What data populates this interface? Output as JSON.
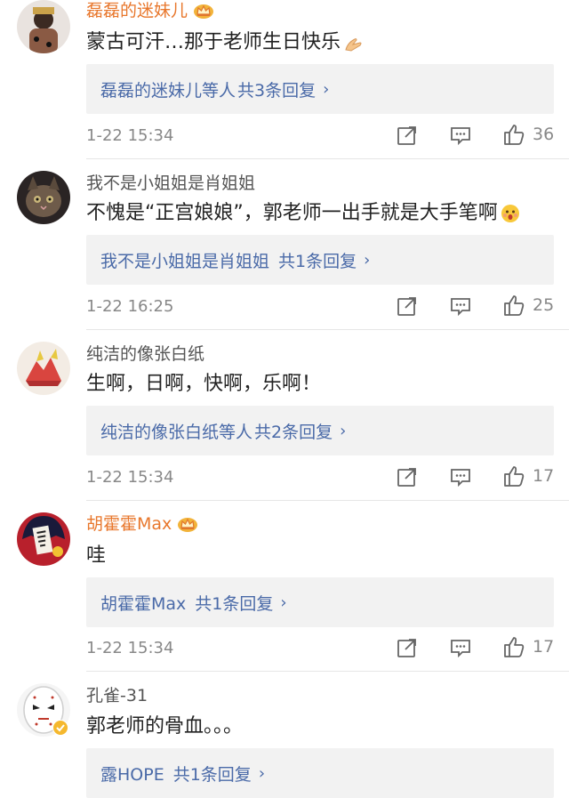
{
  "comments": [
    {
      "username": "磊磊的迷妹儿",
      "vip": true,
      "text": "蒙古可汗…那于老师生日快乐",
      "text_emoji": "praying-hands",
      "reply_who": "磊磊的迷妹儿",
      "reply_etc": "等人",
      "reply_count": "共3条回复",
      "time": "1-22 15:34",
      "likes": "36",
      "avatar_color": "#6b4b3a"
    },
    {
      "username": "我不是小姐姐是肖姐姐",
      "vip": false,
      "text": "不愧是“正宫娘娘”，郭老师一出手就是大手笔啊",
      "text_emoji": "wow-face",
      "reply_who": "我不是小姐姐是肖姐姐",
      "reply_etc": "",
      "reply_count": "共1条回复",
      "time": "1-22 16:25",
      "likes": "25",
      "avatar_color": "#3a3030"
    },
    {
      "username": "纯洁的像张白纸",
      "vip": false,
      "text": "生啊，日啊，快啊，乐啊！",
      "text_emoji": "",
      "reply_who": "纯洁的像张白纸",
      "reply_etc": "等人",
      "reply_count": "共2条回复",
      "time": "1-22 15:34",
      "likes": "17",
      "avatar_color": "#c24a4a"
    },
    {
      "username": "胡霍霍Max",
      "vip": true,
      "text": "哇",
      "text_emoji": "",
      "reply_who": "胡霍霍Max",
      "reply_etc": "",
      "reply_count": "共1条回复",
      "time": "1-22 15:34",
      "likes": "17",
      "avatar_color": "#c21f2f"
    },
    {
      "username": "孔雀-31",
      "vip": false,
      "text": "郭老师的骨血。。。",
      "text_emoji": "",
      "reply_who": "露HOPE",
      "reply_etc": "",
      "reply_count": "共1条回复",
      "time": "",
      "likes": "",
      "avatar_color": "#eeeeee"
    }
  ],
  "icons": {
    "share": "share-icon",
    "comment": "comment-icon",
    "like": "like-icon",
    "crown": "vip-crown-icon"
  },
  "colors": {
    "vip_name": "#e8772c",
    "link": "#4a6aa8",
    "meta": "#888888",
    "reply_bg": "#f2f2f2"
  }
}
